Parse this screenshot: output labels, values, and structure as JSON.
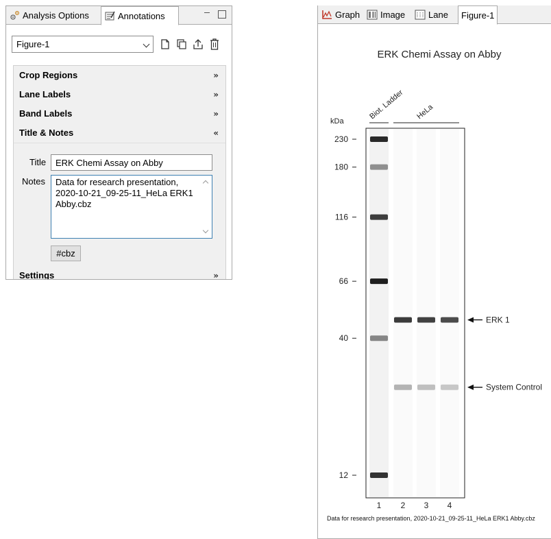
{
  "left_panel": {
    "tabs": [
      {
        "label": "Analysis Options",
        "icon": "gear-icon"
      },
      {
        "label": "Annotations",
        "icon": "annotations-icon"
      }
    ],
    "figure_select": {
      "value": "Figure-1"
    },
    "sections": [
      {
        "label": "Crop Regions",
        "expanded": false
      },
      {
        "label": "Lane Labels",
        "expanded": false
      },
      {
        "label": "Band Labels",
        "expanded": false
      },
      {
        "label": "Title & Notes",
        "expanded": true
      },
      {
        "label": "Settings",
        "expanded": false
      }
    ],
    "title_label": "Title",
    "title_value": "ERK Chemi Assay on Abby",
    "notes_label": "Notes",
    "notes_value": "Data for research presentation, 2020-10-21_09-25-11_HeLa ERK1 Abby.cbz",
    "cbz_button": "#cbz",
    "expand_glyph": "»",
    "collapse_glyph": "«"
  },
  "right_panel": {
    "tabs": [
      {
        "label": "Graph",
        "icon": "graph-icon"
      },
      {
        "label": "Image",
        "icon": "image-icon"
      },
      {
        "label": "Lane",
        "icon": "lane-icon"
      },
      {
        "label": "Figure-1",
        "active": true
      }
    ],
    "caption": "Data for research presentation, 2020-10-21_09-25-11_HeLa ERK1 Abby.cbz"
  },
  "chart_data": {
    "type": "blot",
    "title": "ERK Chemi Assay on Abby",
    "ylabel": "kDa",
    "lane_numbers": [
      "1",
      "2",
      "3",
      "4"
    ],
    "lane_groups": [
      {
        "label": "Biot. Ladder",
        "lanes": [
          1
        ]
      },
      {
        "label": "HeLa",
        "lanes": [
          2,
          3,
          4
        ]
      }
    ],
    "ladder": [
      {
        "mw": 230,
        "label": "230",
        "intensity": 0.95
      },
      {
        "mw": 180,
        "label": "180",
        "intensity": 0.45
      },
      {
        "mw": 116,
        "label": "116",
        "intensity": 0.85
      },
      {
        "mw": 66,
        "label": "66",
        "intensity": 1.0
      },
      {
        "mw": 40,
        "label": "40",
        "intensity": 0.5
      },
      {
        "mw": 12,
        "label": "12",
        "intensity": 0.9
      }
    ],
    "bands": [
      {
        "label": "ERK 1",
        "mw": 47,
        "lanes": [
          2,
          3,
          4
        ],
        "intensities": [
          0.88,
          0.85,
          0.8
        ]
      },
      {
        "label": "System Control",
        "mw": 26,
        "lanes": [
          2,
          3,
          4
        ],
        "intensities": [
          0.28,
          0.22,
          0.18
        ]
      }
    ]
  },
  "colors": {
    "band": "#3a3a3a",
    "panel_bg": "#f0f0f0",
    "accent": "#3c7fb1"
  }
}
